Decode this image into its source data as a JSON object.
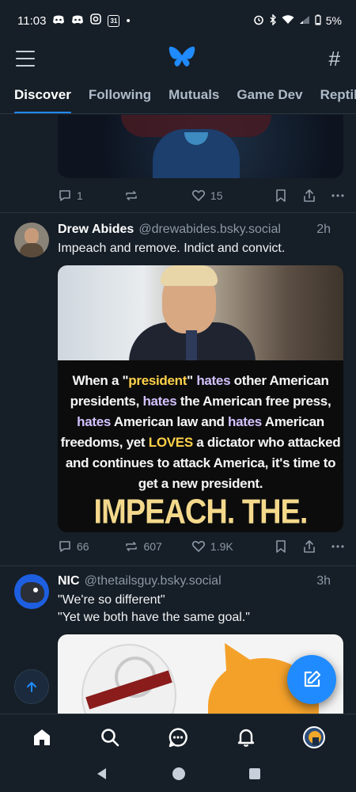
{
  "status_bar": {
    "time": "11:03",
    "dot": "•",
    "battery": "5%",
    "left_icons": [
      "discord-icon",
      "discord-icon",
      "instagram-icon",
      "calendar-icon"
    ],
    "calendar_day": "31",
    "right_icons": [
      "alarm-icon",
      "bluetooth-icon",
      "wifi-icon",
      "signal-icon",
      "battery-icon"
    ]
  },
  "header": {
    "logo": "butterfly-logo",
    "menu_icon": "menu-icon",
    "feeds_icon": "hash-icon",
    "feeds_glyph": "#"
  },
  "tabs": [
    {
      "label": "Discover",
      "active": true
    },
    {
      "label": "Following",
      "active": false
    },
    {
      "label": "Mutuals",
      "active": false
    },
    {
      "label": "Game Dev",
      "active": false
    },
    {
      "label": "Reptile",
      "active": false
    }
  ],
  "posts": [
    {
      "id": "prev",
      "reply_count": "1",
      "repost_count": "",
      "like_count": "15"
    },
    {
      "id": "drew",
      "author": "Drew Abides",
      "handle": "@drewabides.bsky.social",
      "time": "2h",
      "text": "Impeach and remove. Indict and convict.",
      "image_text": {
        "p1": "When a \"",
        "w1": "president",
        "p2": "\" ",
        "w2": "hates",
        "p3": " other American presidents, ",
        "w3": "hates",
        "p4": " the American free press, ",
        "w4": "hates",
        "p5": " American law and ",
        "w5": "hates",
        "p6": " American freedoms, yet ",
        "w6": "LOVES",
        "p7": " a dictator who attacked and continues to attack America, it's time to get a new president.",
        "banner": "IMPEACH. THE. TRAITOR."
      },
      "reply_count": "66",
      "repost_count": "607",
      "like_count": "1.9K"
    },
    {
      "id": "nic",
      "author": "NIC",
      "handle": "@thetailsguy.bsky.social",
      "time": "3h",
      "text_line1": "\"We're so different\"",
      "text_line2": "\"Yet we both have the same goal.\""
    }
  ],
  "bottom_nav": [
    "home-icon",
    "search-icon",
    "chat-icon",
    "bell-icon",
    "profile-avatar"
  ],
  "colors": {
    "background": "#161e27",
    "accent": "#208bfe",
    "muted": "#8b98a5",
    "divider": "#2a3642"
  }
}
